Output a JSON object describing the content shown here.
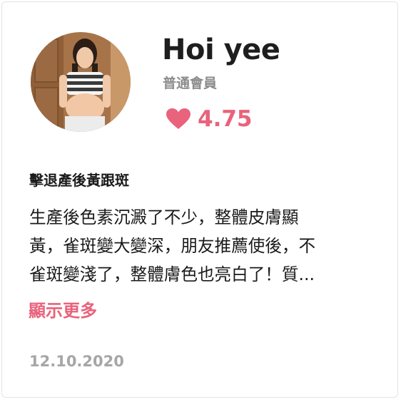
{
  "reviewer": {
    "name": "Hoi yee",
    "membership": "普通會員",
    "rating": "4.75"
  },
  "review": {
    "title": "擊退產後黃跟斑",
    "body_lines": [
      "生產後色素沉澱了不少，整體皮膚顯",
      "黃，雀斑變大變深，朋友推薦使後，不",
      "雀斑變淺了，整體膚色也亮白了！質..."
    ],
    "show_more": "顯示更多",
    "date": "12.10.2020"
  },
  "icons": {
    "rating": "heart-icon"
  },
  "colors": {
    "accent": "#e8637b",
    "muted": "#8c8c8c",
    "date": "#a6a6a6",
    "text": "#1a1a1a"
  }
}
